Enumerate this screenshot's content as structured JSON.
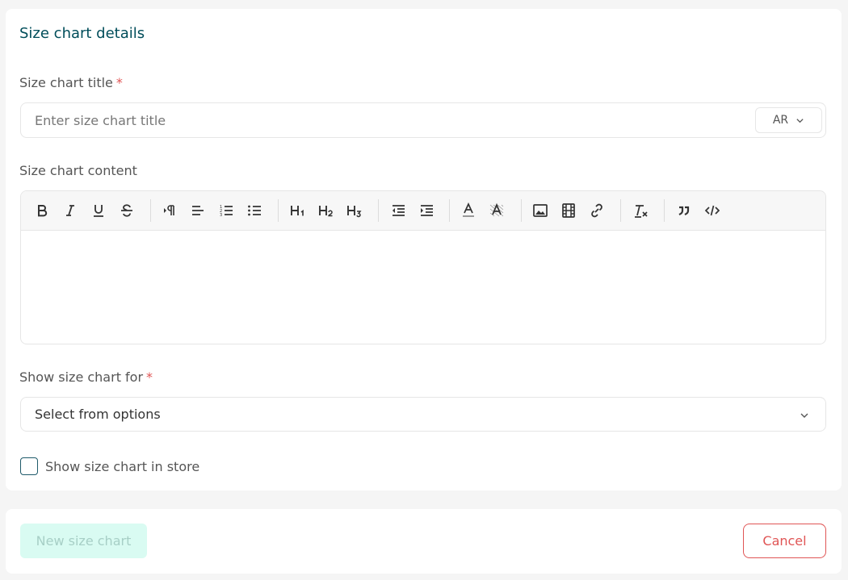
{
  "details": {
    "section_title": "Size chart details",
    "title_label": "Size chart title",
    "required_mark": "*",
    "title_placeholder": "Enter size chart title",
    "lang_label": "AR",
    "content_label": "Size chart content",
    "toolbar_icons": [
      "bold-icon",
      "italic-icon",
      "underline-icon",
      "strikethrough-icon",
      "text-direction-icon",
      "align-left-icon",
      "ordered-list-icon",
      "bullet-list-icon",
      "heading-1-icon",
      "heading-2-icon",
      "heading-3-icon",
      "outdent-icon",
      "indent-icon",
      "font-color-icon",
      "background-color-icon",
      "image-icon",
      "video-icon",
      "link-icon",
      "clear-format-icon",
      "blockquote-icon",
      "code-block-icon"
    ],
    "show_for_label": "Show size chart for",
    "select_value": "Select from options",
    "checkbox_label": "Show size chart in store"
  },
  "footer": {
    "new_label": "New size chart",
    "cancel_label": "Cancel"
  },
  "colors": {
    "accent": "#004d5a",
    "danger": "#e05555",
    "disabled_bg": "#d9fbf2",
    "disabled_text": "#a7cfc6"
  }
}
